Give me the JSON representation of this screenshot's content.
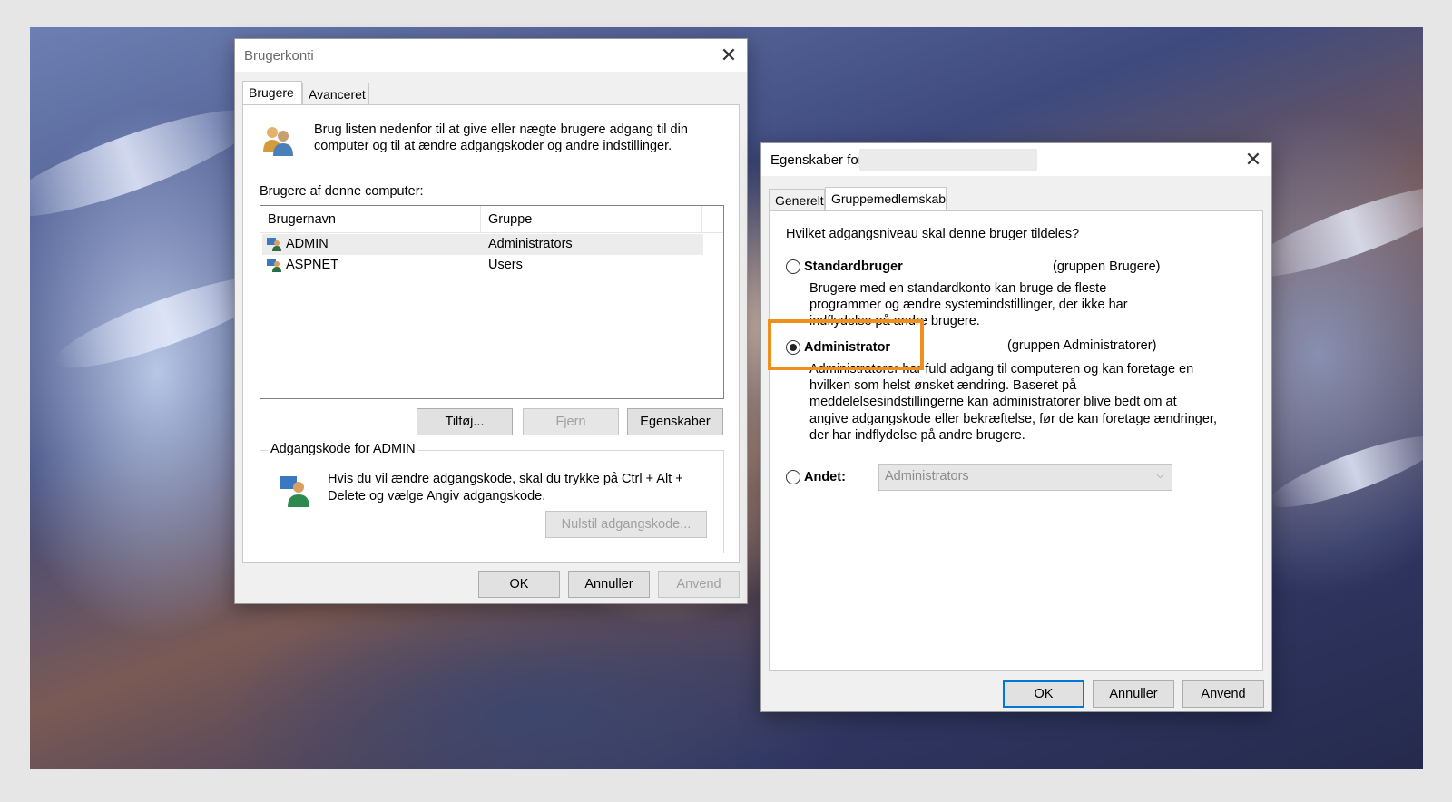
{
  "dialog1": {
    "title": "Brugerkonti",
    "tabs": [
      "Brugere",
      "Avanceret"
    ],
    "intro_line1": "Brug listen nedenfor til at give eller nægte brugere adgang til din",
    "intro_line2": "computer og til at ændre adgangskoder og andre indstillinger.",
    "users_label": "Brugere af denne computer:",
    "columns": [
      "Brugernavn",
      "Gruppe"
    ],
    "rows": [
      {
        "name": "ADMIN",
        "group": "Administrators"
      },
      {
        "name": "ASPNET",
        "group": "Users"
      }
    ],
    "buttons": {
      "add": "Tilføj...",
      "remove": "Fjern",
      "properties": "Egenskaber"
    },
    "password_group": "Adgangskode for ADMIN",
    "password_line1": "Hvis du vil ændre adgangskode, skal du trykke på Ctrl + Alt +",
    "password_line2": "Delete og vælge Angiv adgangskode.",
    "reset_button": "Nulstil adgangskode...",
    "ok": "OK",
    "cancel": "Annuller",
    "apply": "Anvend"
  },
  "dialog2": {
    "title": "Egenskaber for",
    "tabs": [
      "Generelt",
      "Gruppemedlemskab"
    ],
    "question": "Hvilket adgangsniveau skal denne bruger tildeles?",
    "options": {
      "standard": {
        "label": "Standardbruger",
        "group": "(gruppen Brugere)",
        "desc": [
          "Brugere med en standardkonto kan bruge de fleste",
          "programmer og ændre systemindstillinger, der ikke har",
          "indflydelse på andre brugere."
        ]
      },
      "admin": {
        "label": "Administrator",
        "group": "(gruppen Administratorer)",
        "desc": [
          "Administratorer har fuld adgang til computeren og kan foretage en",
          "hvilken som helst ønsket ændring. Baseret på",
          "meddelelsesindstillingerne kan administratorer blive bedt om at",
          "angive adgangskode eller bekræftelse, før de kan foretage ændringer,",
          "der har indflydelse på andre brugere."
        ]
      },
      "other": {
        "label": "Andet:",
        "value": "Administrators"
      }
    },
    "selected_option": "admin",
    "ok": "OK",
    "cancel": "Annuller",
    "apply": "Anvend"
  },
  "accent_colors": {
    "highlight": "#f0901c",
    "focus": "#0078d7"
  }
}
